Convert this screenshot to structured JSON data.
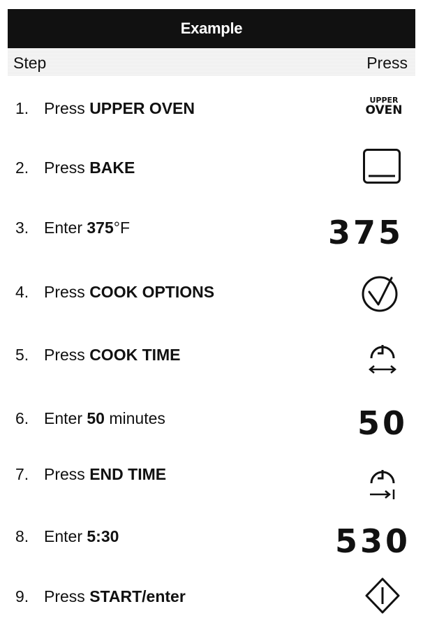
{
  "header": {
    "title": "Example",
    "step_label": "Step",
    "press_label": "Press"
  },
  "steps": [
    {
      "num": "1.",
      "prefix": "Press",
      "bold": "UPPER OVEN",
      "suffix": "",
      "press_type": "text-button",
      "press_text": [
        "UPPER",
        "OVEN"
      ]
    },
    {
      "num": "2.",
      "prefix": "Press",
      "bold": "BAKE",
      "suffix": "",
      "press_type": "icon",
      "press_icon": "bake-icon"
    },
    {
      "num": "3.",
      "prefix": "Enter",
      "bold": "375",
      "suffix": "°F",
      "press_type": "number",
      "press_value": "375"
    },
    {
      "num": "4.",
      "prefix": "Press",
      "bold": "COOK OPTIONS",
      "suffix": "",
      "press_type": "icon",
      "press_icon": "checkmark-circle-icon"
    },
    {
      "num": "5.",
      "prefix": "Press",
      "bold": "COOK TIME",
      "suffix": "",
      "press_type": "icon",
      "press_icon": "cook-time-clock-icon"
    },
    {
      "num": "6.",
      "prefix": "Enter",
      "bold": "50",
      "suffix": " minutes",
      "press_type": "number",
      "press_value": "50"
    },
    {
      "num": "7.",
      "prefix": "Press",
      "bold": "END TIME",
      "suffix": "",
      "press_type": "icon",
      "press_icon": "end-time-clock-icon"
    },
    {
      "num": "8.",
      "prefix": "Enter",
      "bold": "5:30",
      "suffix": "",
      "press_type": "number",
      "press_value": "530"
    },
    {
      "num": "9.",
      "prefix": "Press",
      "bold": "START/enter",
      "suffix": "",
      "press_type": "icon",
      "press_icon": "start-diamond-icon"
    }
  ]
}
